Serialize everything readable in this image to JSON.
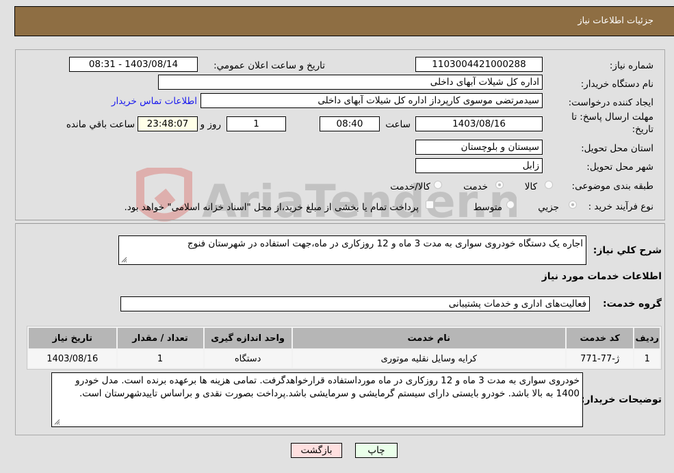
{
  "header": {
    "title": "جزئیات اطلاعات نیاز"
  },
  "form": {
    "need_number": {
      "label": "شماره نیاز:",
      "value": "1103004421000288"
    },
    "announce_datetime": {
      "label": "تاریخ و ساعت اعلان عمومي:",
      "value": "1403/08/14 - 08:31"
    },
    "buyer_org": {
      "label": "نام دستگاه خريدار:",
      "value": "اداره کل شیلات آبهای داخلی"
    },
    "requester": {
      "label": "ایجاد کننده درخواست:",
      "value": "سیدمرتضی موسوی کارپرداز اداره کل شیلات آبهای داخلی"
    },
    "buyer_contact_link": "اطلاعات تماس خریدار",
    "deadline": {
      "label_line1": "مهلت ارسال پاسخ: تا",
      "label_line2": "تاريخ:",
      "date": "1403/08/16",
      "time_label": "ساعت",
      "time": "08:40",
      "days": "1",
      "days_label": "روز و",
      "remaining": "23:48:07",
      "remaining_label": "ساعت باقي مانده"
    },
    "province": {
      "label": "استان محل تحویل:",
      "value": "سیستان و بلوچستان"
    },
    "city": {
      "label": "شهر محل تحویل:",
      "value": "زابل"
    },
    "category": {
      "label": "طبقه بندی موضوعی:",
      "options": [
        "کالا",
        "خدمت",
        "کالا/خدمت"
      ],
      "selected": "خدمت"
    },
    "purchase_process": {
      "label": "نوع فرآیند خرید :",
      "options": [
        "جزيي",
        "متوسط"
      ],
      "selected": "جزيي",
      "treasury_checkbox_label": "پرداخت تمام یا بخشی از مبلغ خرید،از محل \"اسناد خزانه اسلامی\" خواهد بود.",
      "treasury_checked": false
    }
  },
  "details": {
    "general_desc": {
      "label": "شرح کلي نياز:",
      "value": "اجاره یک دستگاه خودروی سواری به مدت 3 ماه و 12 روزکاری در ماه،جهت استفاده در شهرستان فنوج"
    },
    "services_section_title": "اطلاعات خدمات مورد نیاز",
    "service_group": {
      "label": "گروه خدمت:",
      "value": "فعالیت‌های اداری و خدمات پشتیبانی"
    },
    "table": {
      "columns": [
        "رديف",
        "کد خدمت",
        "نام خدمت",
        "واحد اندازه گیری",
        "تعداد / مقدار",
        "تاريخ نياز"
      ],
      "rows": [
        [
          "1",
          "ژ-77-771",
          "کرایه وسایل نقلیه موتوری",
          "دستگاه",
          "1",
          "1403/08/16"
        ]
      ]
    },
    "buyer_notes": {
      "label": "توضیحات خریدار:",
      "value": "خودروی سواری به مدت 3 ماه و 12 روزکاری در ماه مورداستفاده قرارخواهدگرفت. تمامی هزینه ها برعهده برنده است. مدل خودرو 1400 به بالا باشد. خودرو بایستی دارای سیستم گرمایشی و سرمایشی باشد.پرداخت بصورت نقدی و براساس تاییدشهرستان است."
    }
  },
  "buttons": {
    "print": "چاپ",
    "back": "بازگشت"
  },
  "watermark": {
    "text": "AriaTender.neT"
  },
  "colors": {
    "header_bg": "#8e6e43",
    "link": "#1a1aee",
    "print_btn_bg": "#eaffea",
    "back_btn_bg": "#ffe0e0",
    "remaining_bg": "#ffffe8"
  }
}
